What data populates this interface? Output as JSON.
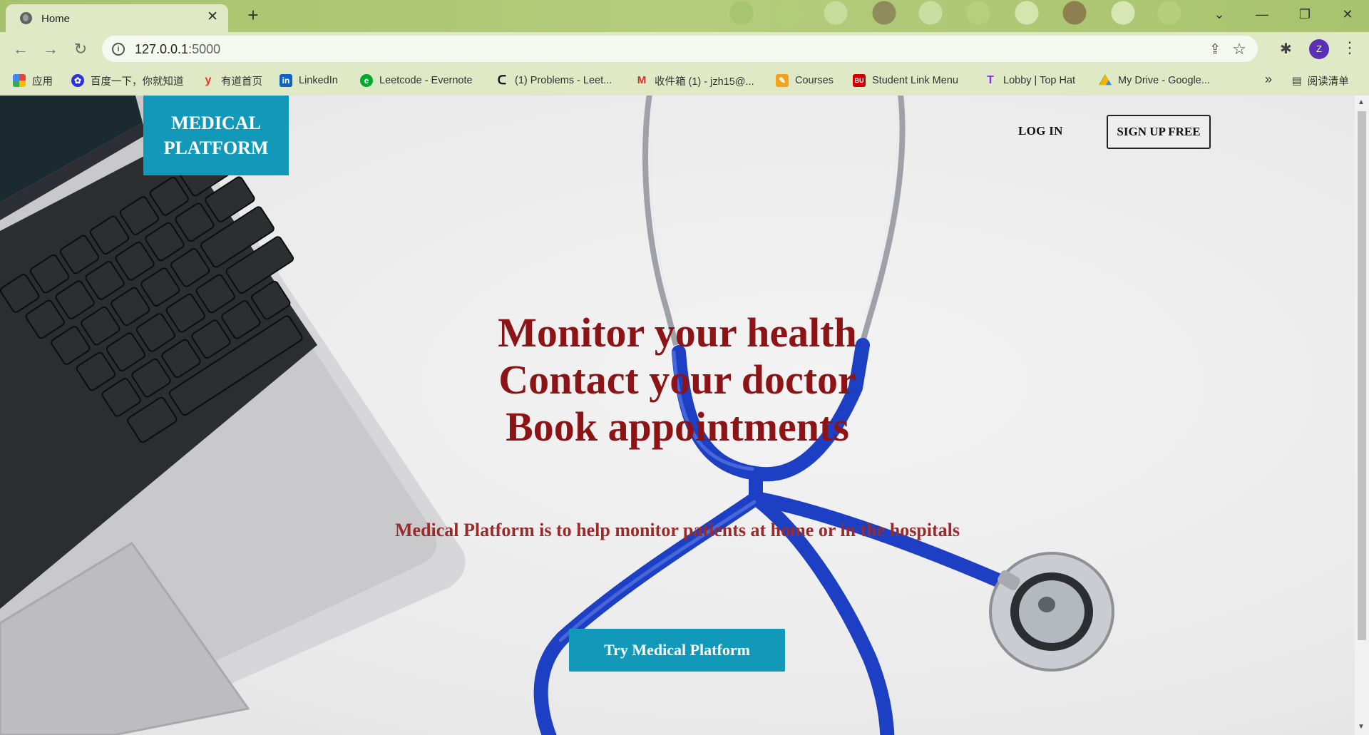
{
  "browser": {
    "tab_title": "Home",
    "url_host": "127.0.0.1",
    "url_port": ":5000",
    "avatar_letter": "Z",
    "bookmarks": [
      {
        "label": "应用",
        "icon": "apps-grid-icon"
      },
      {
        "label": "百度一下，你就知道",
        "icon": "baidu-icon"
      },
      {
        "label": "有道首页",
        "icon": "youdao-icon"
      },
      {
        "label": "LinkedIn",
        "icon": "linkedin-icon"
      },
      {
        "label": "Leetcode - Evernote",
        "icon": "evernote-icon"
      },
      {
        "label": "(1) Problems - Leet...",
        "icon": "leetcode-icon"
      },
      {
        "label": "收件箱 (1) - jzh15@...",
        "icon": "gmail-icon"
      },
      {
        "label": "Courses",
        "icon": "courses-icon"
      },
      {
        "label": "Student Link Menu",
        "icon": "bu-icon"
      },
      {
        "label": "Lobby | Top Hat",
        "icon": "tophat-icon"
      },
      {
        "label": "My Drive - Google...",
        "icon": "google-drive-icon"
      }
    ],
    "reading_list": "阅读清单"
  },
  "page": {
    "logo_line1": "MEDICAL",
    "logo_line2": "PLATFORM",
    "login_label": "LOG IN",
    "signup_label": "SIGN UP FREE",
    "headline": [
      "Monitor your health",
      "Contact your doctor",
      "Book appointments"
    ],
    "tagline": "Medical Platform is to help monitor patients at home or in the hospitals",
    "cta_label": "Try Medical Platform"
  },
  "colors": {
    "brand_teal": "#1299b9",
    "headline_red": "#8c1417",
    "tagline_red": "#9b2a2a",
    "stethoscope_blue": "#1c3fc4"
  }
}
